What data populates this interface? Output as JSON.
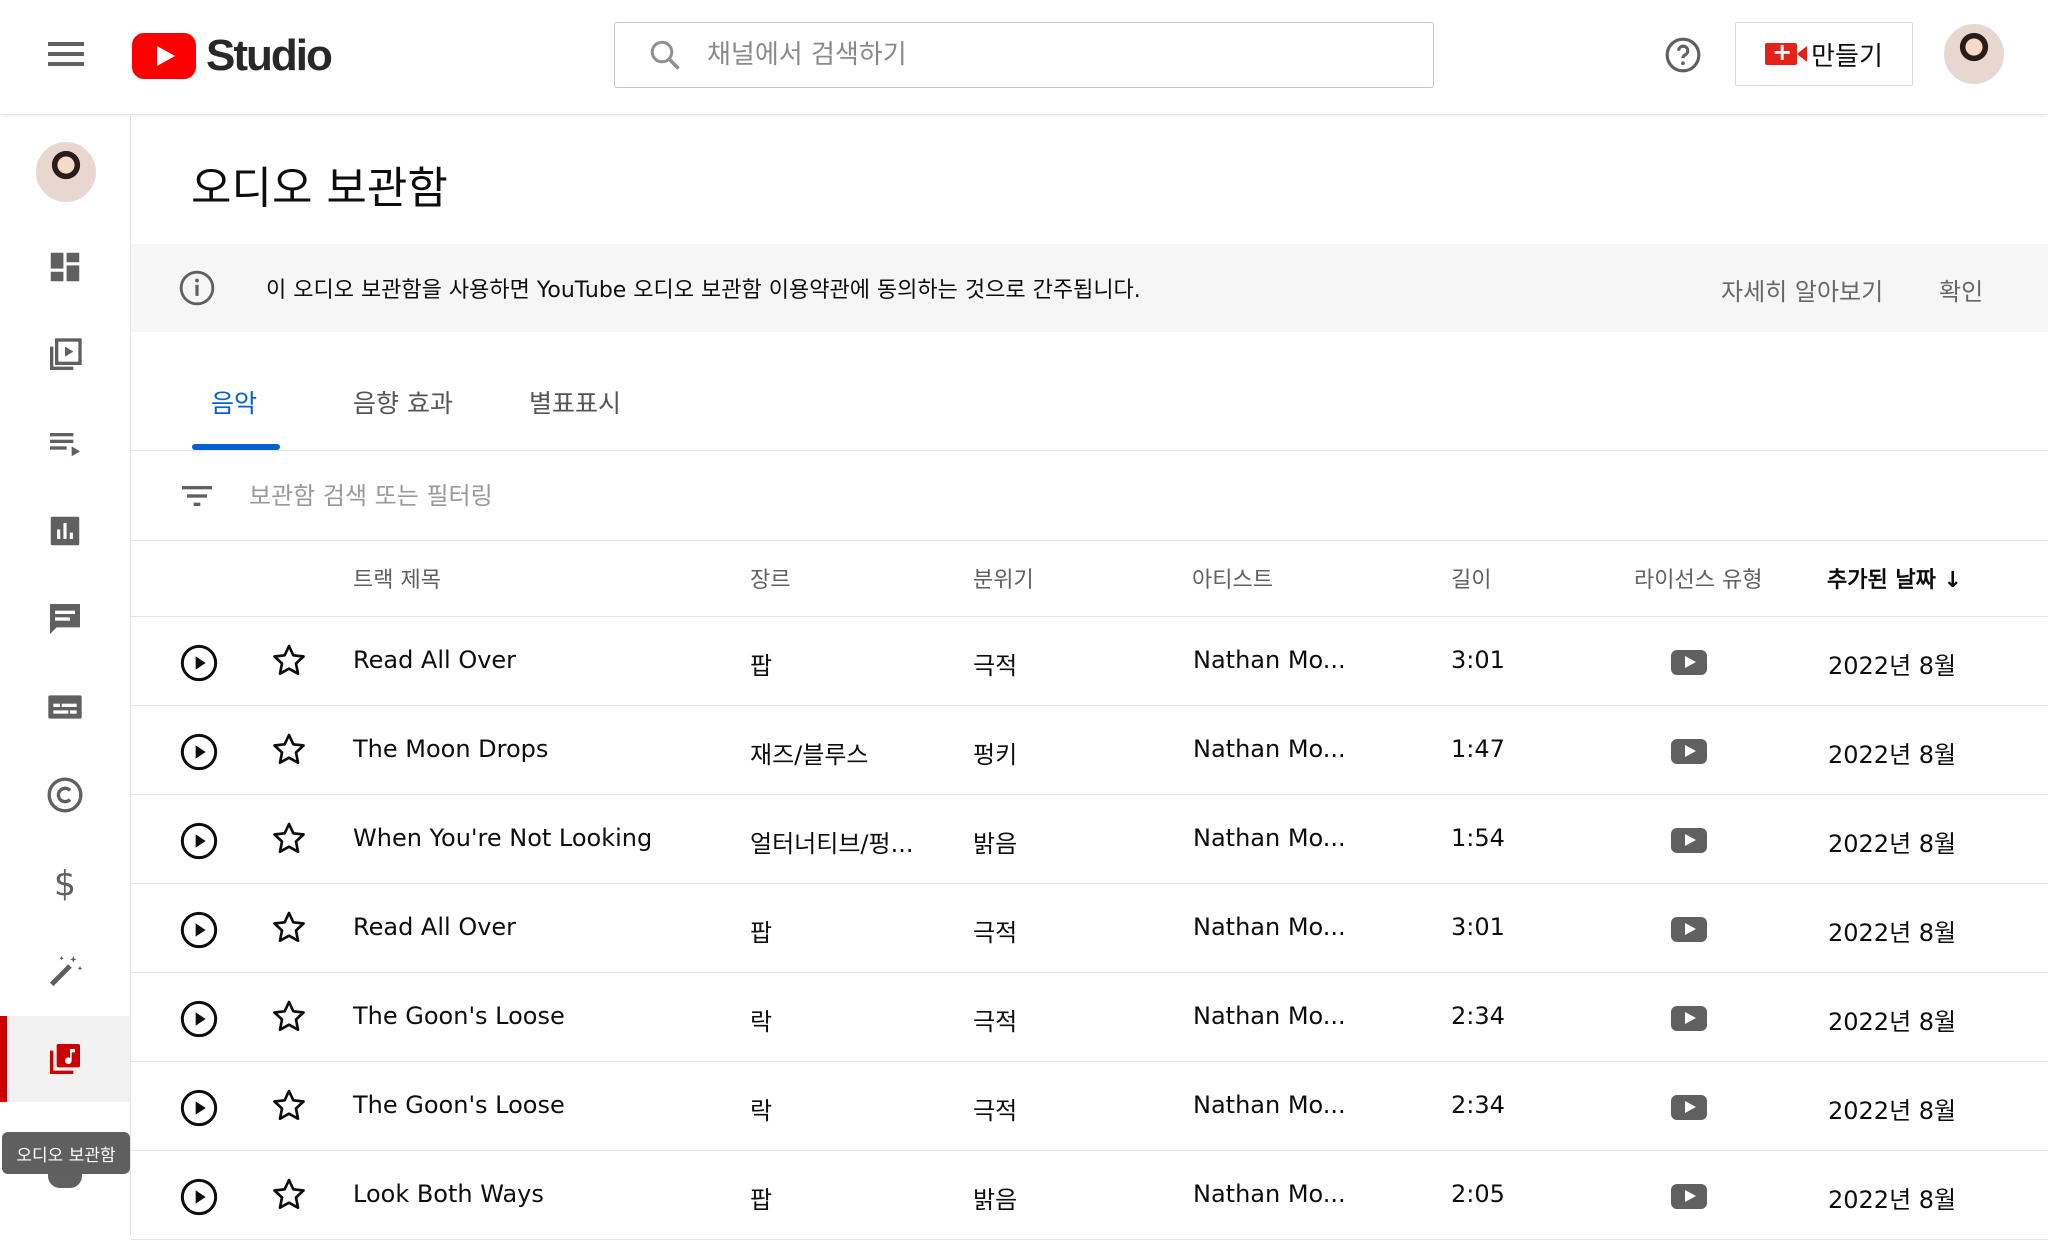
{
  "header": {
    "logo_text": "Studio",
    "search_placeholder": "채널에서 검색하기",
    "create_label": "만들기"
  },
  "sidebar": {
    "items": [
      {
        "name": "dashboard-icon"
      },
      {
        "name": "content-icon"
      },
      {
        "name": "playlists-icon"
      },
      {
        "name": "analytics-icon"
      },
      {
        "name": "comments-icon"
      },
      {
        "name": "subtitles-icon"
      },
      {
        "name": "copyright-icon"
      },
      {
        "name": "earn-icon"
      },
      {
        "name": "customization-icon"
      },
      {
        "name": "audio-library-icon",
        "active": true
      }
    ],
    "tooltip": "오디오 보관함"
  },
  "page": {
    "title": "오디오 보관함",
    "notice": "이 오디오 보관함을 사용하면 YouTube 오디오 보관함 이용약관에 동의하는 것으로 간주됩니다.",
    "notice_link": "자세히 알아보기",
    "notice_ok": "확인",
    "tabs": [
      "음악",
      "음향 효과",
      "별표표시"
    ],
    "active_tab": 0,
    "filter_placeholder": "보관함 검색 또는 필터링"
  },
  "table": {
    "columns": [
      "트랙 제목",
      "장르",
      "분위기",
      "아티스트",
      "길이",
      "라이선스 유형",
      "추가된 날짜 ↓"
    ],
    "rows": [
      {
        "title": "Read All Over",
        "genre": "팝",
        "mood": "극적",
        "artist": "Nathan Mo...",
        "duration": "3:01",
        "date": "2022년 8월"
      },
      {
        "title": "The Moon Drops",
        "genre": "재즈/블루스",
        "mood": "펑키",
        "artist": "Nathan Mo...",
        "duration": "1:47",
        "date": "2022년 8월"
      },
      {
        "title": "When You're Not Looking",
        "genre": "얼터너티브/펑...",
        "mood": "밝음",
        "artist": "Nathan Mo...",
        "duration": "1:54",
        "date": "2022년 8월"
      },
      {
        "title": "Read All Over",
        "genre": "팝",
        "mood": "극적",
        "artist": "Nathan Mo...",
        "duration": "3:01",
        "date": "2022년 8월"
      },
      {
        "title": "The Goon's Loose",
        "genre": "락",
        "mood": "극적",
        "artist": "Nathan Mo...",
        "duration": "2:34",
        "date": "2022년 8월"
      },
      {
        "title": "The Goon's Loose",
        "genre": "락",
        "mood": "극적",
        "artist": "Nathan Mo...",
        "duration": "2:34",
        "date": "2022년 8월"
      },
      {
        "title": "Look Both Ways",
        "genre": "팝",
        "mood": "밝음",
        "artist": "Nathan Mo...",
        "duration": "2:05",
        "date": "2022년 8월"
      }
    ]
  }
}
